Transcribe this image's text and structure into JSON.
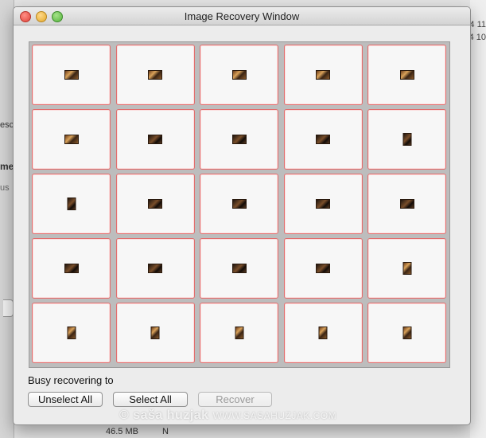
{
  "background_app": {
    "left_texts": [
      "esc",
      "me",
      "us"
    ],
    "right_texts": [
      "4 11",
      "4 10"
    ],
    "bottom_size": "46.5 MB",
    "bottom_mark": "N"
  },
  "window": {
    "title": "Image Recovery Window",
    "buttons": {
      "close": "close-button",
      "minimize": "minimize-button",
      "zoom": "zoom-button"
    }
  },
  "thumbnails": [
    {
      "orientation": "landscape",
      "tone": "warm"
    },
    {
      "orientation": "landscape",
      "tone": "warm"
    },
    {
      "orientation": "landscape",
      "tone": "warm"
    },
    {
      "orientation": "landscape",
      "tone": "warm"
    },
    {
      "orientation": "landscape",
      "tone": "warm"
    },
    {
      "orientation": "landscape",
      "tone": "warm"
    },
    {
      "orientation": "landscape",
      "tone": "dark"
    },
    {
      "orientation": "landscape",
      "tone": "dark"
    },
    {
      "orientation": "landscape",
      "tone": "dark"
    },
    {
      "orientation": "portrait",
      "tone": "dark"
    },
    {
      "orientation": "portrait",
      "tone": "dark"
    },
    {
      "orientation": "landscape",
      "tone": "dark"
    },
    {
      "orientation": "landscape",
      "tone": "dark"
    },
    {
      "orientation": "landscape",
      "tone": "dark"
    },
    {
      "orientation": "landscape",
      "tone": "dark"
    },
    {
      "orientation": "landscape",
      "tone": "dark"
    },
    {
      "orientation": "landscape",
      "tone": "dark"
    },
    {
      "orientation": "landscape",
      "tone": "dark"
    },
    {
      "orientation": "landscape",
      "tone": "dark"
    },
    {
      "orientation": "portrait",
      "tone": "warm"
    },
    {
      "orientation": "portrait",
      "tone": "warm"
    },
    {
      "orientation": "portrait",
      "tone": "warm"
    },
    {
      "orientation": "portrait",
      "tone": "warm"
    },
    {
      "orientation": "portrait",
      "tone": "warm"
    },
    {
      "orientation": "portrait",
      "tone": "warm"
    }
  ],
  "status": {
    "label": "Busy recovering to"
  },
  "actions": {
    "unselect_all": "Unselect All",
    "select_all": "Select All",
    "recover": "Recover"
  },
  "watermark": {
    "name": "© saša huzjak",
    "site": "WWW.SASAHUZJAK.COM"
  },
  "colors": {
    "thumb_border": "#e26d6d",
    "window_bg": "#ececec"
  }
}
